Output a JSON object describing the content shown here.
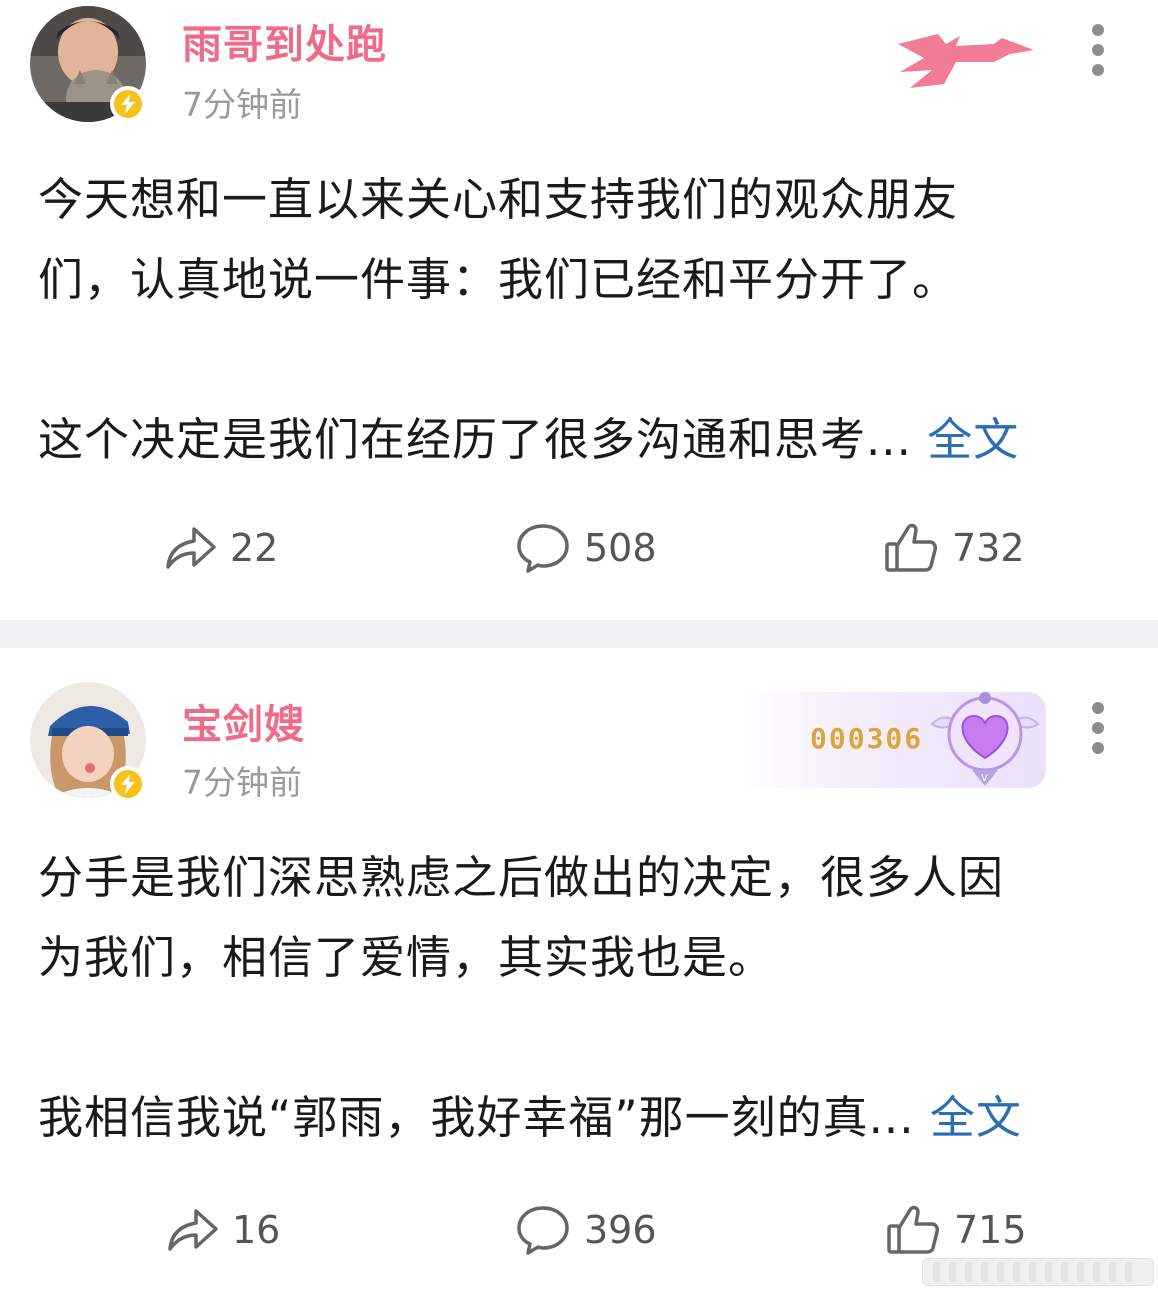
{
  "posts": [
    {
      "username": "雨哥到处跑",
      "time": "7分钟前",
      "text_line1": "今天想和一直以来关心和支持我们的观众朋友",
      "text_line2": "们，认真地说一件事：我们已经和平分开了。",
      "text_line3": "这个决定是我们在经历了很多沟通和思考...",
      "fulltext_label": "全文",
      "reposts": "22",
      "comments": "508",
      "likes": "732"
    },
    {
      "username": "宝剑嫂",
      "time": "7分钟前",
      "badge_number": "000306",
      "text_line1": "分手是我们深思熟虑之后做出的决定，很多人因",
      "text_line2": "为我们，相信了爱情，其实我也是。",
      "text_line3": "我相信我说“郭雨，我好幸福”那一刻的真...",
      "fulltext_label": "全文",
      "reposts": "16",
      "comments": "396",
      "likes": "715"
    }
  ],
  "colors": {
    "username": "#ee6b8a",
    "link": "#2a6fb3",
    "verified": "#f6c21b",
    "separator": "#f1f1f3"
  },
  "icons": [
    "repost-icon",
    "comment-icon",
    "like-icon",
    "more-icon",
    "verified-icon"
  ]
}
